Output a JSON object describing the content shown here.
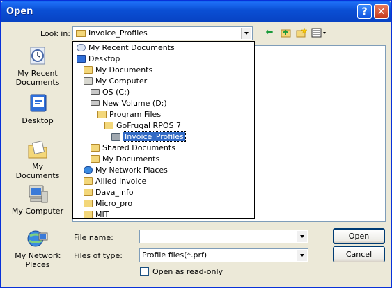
{
  "window": {
    "title": "Open",
    "help_glyph": "?",
    "close_glyph": "✕"
  },
  "lookin": {
    "label": "Look in:",
    "value": "Invoice_Profiles"
  },
  "toolbar": [
    "back-icon",
    "up-folder-icon",
    "new-folder-icon",
    "view-menu-icon"
  ],
  "places": [
    {
      "label": "My Recent Documents",
      "icon": "recent-documents-icon"
    },
    {
      "label": "Desktop",
      "icon": "desktop-icon"
    },
    {
      "label": "My Documents",
      "icon": "my-documents-icon"
    },
    {
      "label": "My Computer",
      "icon": "my-computer-icon"
    },
    {
      "label": "My Network Places",
      "icon": "network-places-icon"
    }
  ],
  "lookin_list": [
    {
      "label": "My Recent Documents",
      "icon": "recent-documents-icon"
    },
    {
      "label": "Desktop",
      "icon": "desktop-icon"
    },
    {
      "label": "My Documents",
      "icon": "folder-icon"
    },
    {
      "label": "My Computer",
      "icon": "computer-icon"
    },
    {
      "label": "OS (C:)",
      "icon": "drive-icon"
    },
    {
      "label": "New Volume (D:)",
      "icon": "drive-icon"
    },
    {
      "label": "Program Files",
      "icon": "folder-icon"
    },
    {
      "label": "GoFrugal RPOS 7",
      "icon": "folder-icon"
    },
    {
      "label": "Invoice_Profiles",
      "icon": "folder-open-icon",
      "selected": true
    },
    {
      "label": "Shared Documents",
      "icon": "folder-icon"
    },
    {
      "label": "My Documents",
      "icon": "folder-icon"
    },
    {
      "label": "My Network Places",
      "icon": "network-icon"
    },
    {
      "label": "Allied Invoice",
      "icon": "folder-icon"
    },
    {
      "label": "Dava_info",
      "icon": "folder-icon"
    },
    {
      "label": "Micro_pro",
      "icon": "folder-icon"
    },
    {
      "label": "MIT",
      "icon": "folder-icon"
    }
  ],
  "filename": {
    "label": "File name:",
    "value": ""
  },
  "filetype": {
    "label": "Files of type:",
    "value": "Profile files(*.prf)"
  },
  "readonly": {
    "label": "Open as read-only",
    "checked": false
  },
  "buttons": {
    "open": "Open",
    "cancel": "Cancel"
  }
}
